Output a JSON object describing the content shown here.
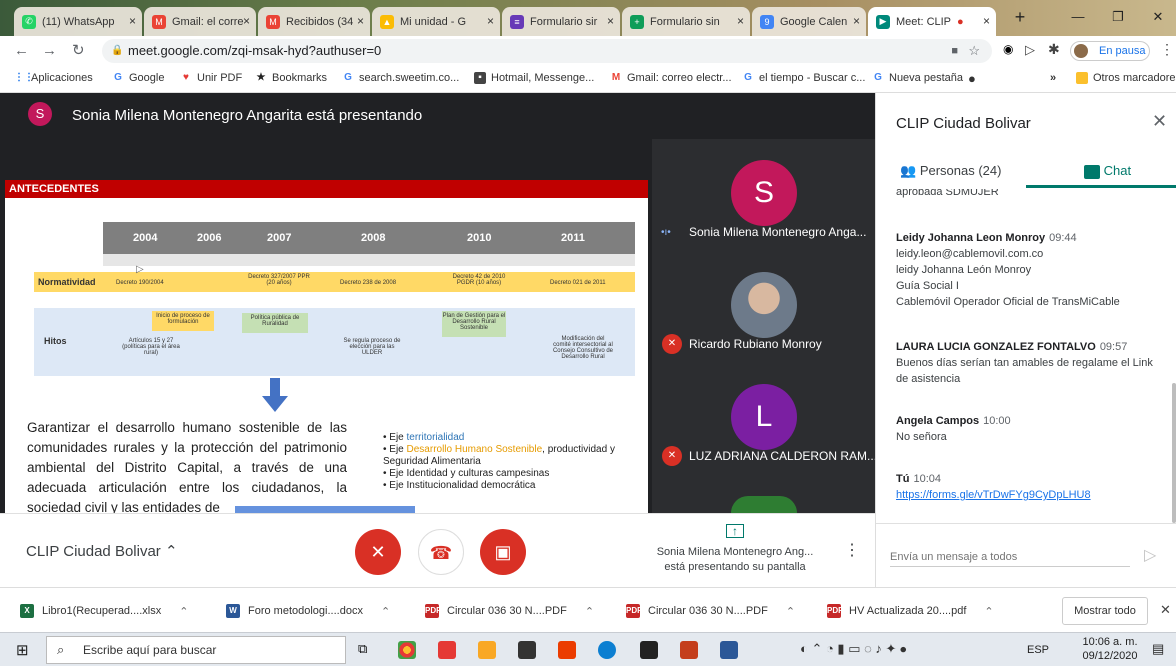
{
  "tabs": [
    {
      "label": "(11) WhatsApp",
      "x": "×"
    },
    {
      "label": "Gmail: el corre",
      "x": "×"
    },
    {
      "label": "Recibidos (34",
      "x": "×"
    },
    {
      "label": "Mi unidad - G",
      "x": "×"
    },
    {
      "label": "Formulario sir",
      "x": "×"
    },
    {
      "label": "Formulario sin",
      "x": "×"
    },
    {
      "label": "Google Calen",
      "x": "×"
    },
    {
      "label": "Meet: CLIP",
      "x": "×"
    }
  ],
  "address": {
    "url": "meet.google.com/zqi-msak-hyd?authuser=0",
    "profile": "En pausa"
  },
  "bookmarks": [
    "Aplicaciones",
    "Google",
    "Unir PDF",
    "Bookmarks",
    "search.sweetim.co...",
    "Hotmail, Messenge...",
    "Gmail: correo electr...",
    "el tiempo - Buscar c...",
    "Nueva pestaña",
    "Otros marcadores"
  ],
  "presenter": {
    "initial": "S",
    "text": "Sonia Milena Montenegro Angarita está presentando"
  },
  "slide": {
    "heading": "ANTECEDENTES",
    "years": [
      "2004",
      "2006",
      "2007",
      "2008",
      "2010",
      "2011"
    ],
    "row1_label": "Normatividad",
    "row1_cells": [
      "Decreto 190/2004",
      "Decreto 327/2007 PPR (20 años)",
      "Decreto 238 de 2008",
      "Decreto 42 de 2010 PGDR (10 años)",
      "Decreto 021 de 2011"
    ],
    "row2_label": "Hitos",
    "row2_cells": [
      "Inicio de proceso de formulación",
      "Política pública de Ruralidad",
      "Plan de Gestión para el Desarrollo Rural Sostenible",
      "Artículos 15 y 27 (políticas para el área rural)",
      "Se regula proceso de elección para las ULDER",
      "Modificación del comité intersectorial al Consejo Consultivo de Desarrollo Rural"
    ],
    "paragraph": "Garantizar el desarrollo humano sostenible de las comunidades rurales y la protección del patrimonio ambiental del Distrito Capital, a través de una adecuada articulación entre los ciudadanos, la sociedad civil y las entidades de",
    "bullets": [
      {
        "pre": "Eje ",
        "hl": "territorialidad",
        "post": ""
      },
      {
        "pre": "Eje ",
        "hl": "Desarrollo Humano Sostenible",
        "post": ", productividad y Seguridad Alimentaria"
      },
      {
        "pre": "Eje Identidad y culturas campesinas",
        "hl": "",
        "post": ""
      },
      {
        "pre": "Eje Institucionalidad democrática",
        "hl": "",
        "post": ""
      }
    ]
  },
  "participants": [
    {
      "initial": "S",
      "name": "Sonia Milena Montenegro Anga...",
      "color": "#c2185b"
    },
    {
      "initial": "",
      "name": "Ricardo Rubiano Monroy",
      "color": "#555"
    },
    {
      "initial": "L",
      "name": "LUZ ADRIANA CALDERON RAM...",
      "color": "#7b1fa2"
    }
  ],
  "bottom": {
    "meeting": "CLIP Ciudad Bolivar",
    "present_line1": "Sonia Milena Montenegro Ang...",
    "present_line2": "está presentando su pantalla"
  },
  "chat": {
    "title": "CLIP Ciudad Bolivar",
    "people_tab": "Personas (24)",
    "chat_tab": "Chat",
    "cut_text": "aprobada SDMUJER",
    "messages": [
      {
        "who": "Leidy Johanna Leon Monroy",
        "time": "09:44",
        "lines": [
          "leidy.leon@cablemovil.com.co",
          "leidy Johanna León Monroy",
          "Guía Social I",
          "Cablemóvil Operador Oficial de TransMiCable"
        ]
      },
      {
        "who": "LAURA LUCIA GONZALEZ FONTALVO",
        "time": "09:57",
        "lines": [
          "Buenos días serían tan amables de regalame el Link de asistencia"
        ]
      },
      {
        "who": "Angela Campos",
        "time": "10:00",
        "lines": [
          "No señora"
        ]
      },
      {
        "who": "Tú",
        "time": "10:04",
        "lines": [
          "https://forms.gle/vTrDwFYg9CyDpLHU8"
        ]
      }
    ],
    "placeholder": "Envía un mensaje a todos"
  },
  "downloads": [
    {
      "name": "Libro1(Recuperad....xlsx",
      "kind": "xlsx"
    },
    {
      "name": "Foro metodologi....docx",
      "kind": "docx"
    },
    {
      "name": "Circular 036 30 N....PDF",
      "kind": "pdf"
    },
    {
      "name": "Circular 036 30 N....PDF",
      "kind": "pdf"
    },
    {
      "name": "HV Actualizada 20....pdf",
      "kind": "pdf"
    }
  ],
  "show_all": "Mostrar todo",
  "taskbar": {
    "search": "Escribe aquí para buscar",
    "lang": "ESP",
    "time": "10:06 a. m.",
    "date": "09/12/2020"
  }
}
